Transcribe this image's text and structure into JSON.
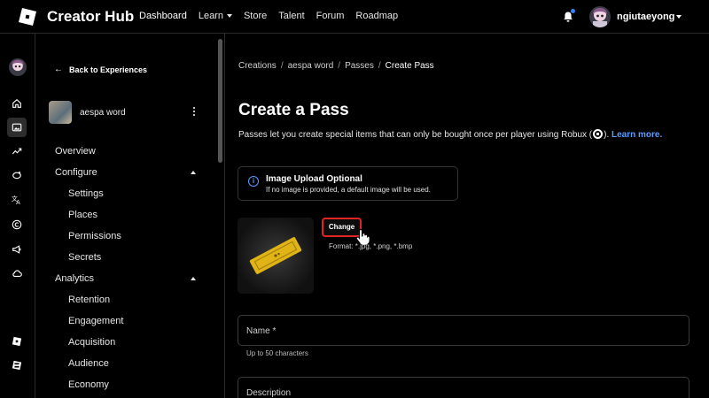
{
  "app": {
    "title": "Creator Hub"
  },
  "nav": {
    "items": [
      "Dashboard",
      "Learn",
      "Store",
      "Talent",
      "Forum",
      "Roadmap"
    ]
  },
  "user": {
    "name": "ngiutaeyong"
  },
  "sidebar": {
    "back_label": "Back to Experiences",
    "experience_name": "aespa word",
    "menu": {
      "overview": "Overview",
      "configure": "Configure",
      "settings": "Settings",
      "places": "Places",
      "permissions": "Permissions",
      "secrets": "Secrets",
      "analytics": "Analytics",
      "retention": "Retention",
      "engagement": "Engagement",
      "acquisition": "Acquisition",
      "audience": "Audience",
      "economy": "Economy"
    }
  },
  "breadcrumb": [
    "Creations",
    "aespa word",
    "Passes",
    "Create Pass"
  ],
  "main": {
    "title": "Create a Pass",
    "description_pre": "Passes let you create special items that can only be bought once per player using Robux (",
    "description_post": ").",
    "learn_more": "Learn more.",
    "info_title": "Image Upload Optional",
    "info_text": "If no image is provided, a default image will be used.",
    "change_button": "Change",
    "format_text": "Format: *.jpg, *.png, *.bmp",
    "name_label": "Name *",
    "name_helper": "Up to 50 characters",
    "description_label": "Description"
  },
  "colors": {
    "accent": "#5b9cff",
    "highlight": "#e02424",
    "notification": "#3b82f6"
  }
}
